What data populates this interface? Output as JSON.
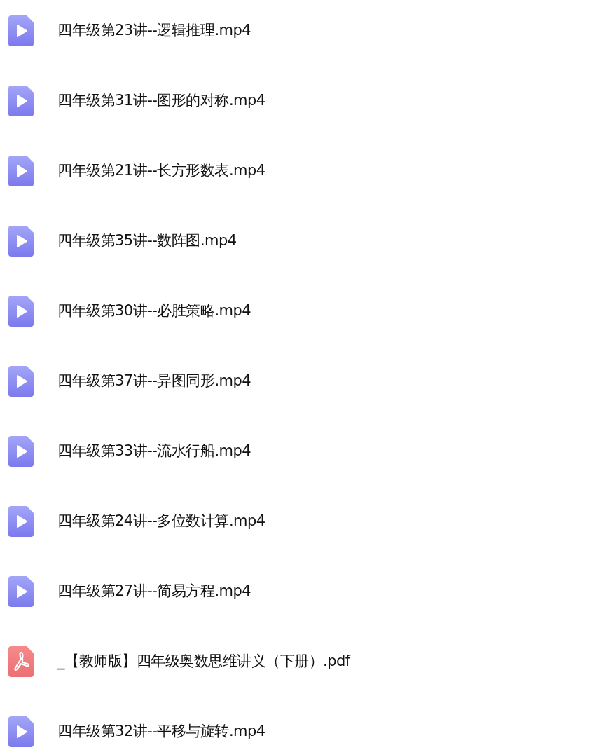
{
  "files": [
    {
      "kind": "video",
      "name": "四年级第23讲--逻辑推理.mp4"
    },
    {
      "kind": "video",
      "name": "四年级第31讲--图形的对称.mp4"
    },
    {
      "kind": "video",
      "name": "四年级第21讲--长方形数表.mp4"
    },
    {
      "kind": "video",
      "name": "四年级第35讲--数阵图.mp4"
    },
    {
      "kind": "video",
      "name": "四年级第30讲--必胜策略.mp4"
    },
    {
      "kind": "video",
      "name": "四年级第37讲--异图同形.mp4"
    },
    {
      "kind": "video",
      "name": "四年级第33讲--流水行船.mp4"
    },
    {
      "kind": "video",
      "name": "四年级第24讲--多位数计算.mp4"
    },
    {
      "kind": "video",
      "name": "四年级第27讲--简易方程.mp4"
    },
    {
      "kind": "pdf",
      "name": "_【教师版】四年级奥数思维讲义（下册）.pdf"
    },
    {
      "kind": "video",
      "name": "四年级第32讲--平移与旋转.mp4"
    }
  ]
}
